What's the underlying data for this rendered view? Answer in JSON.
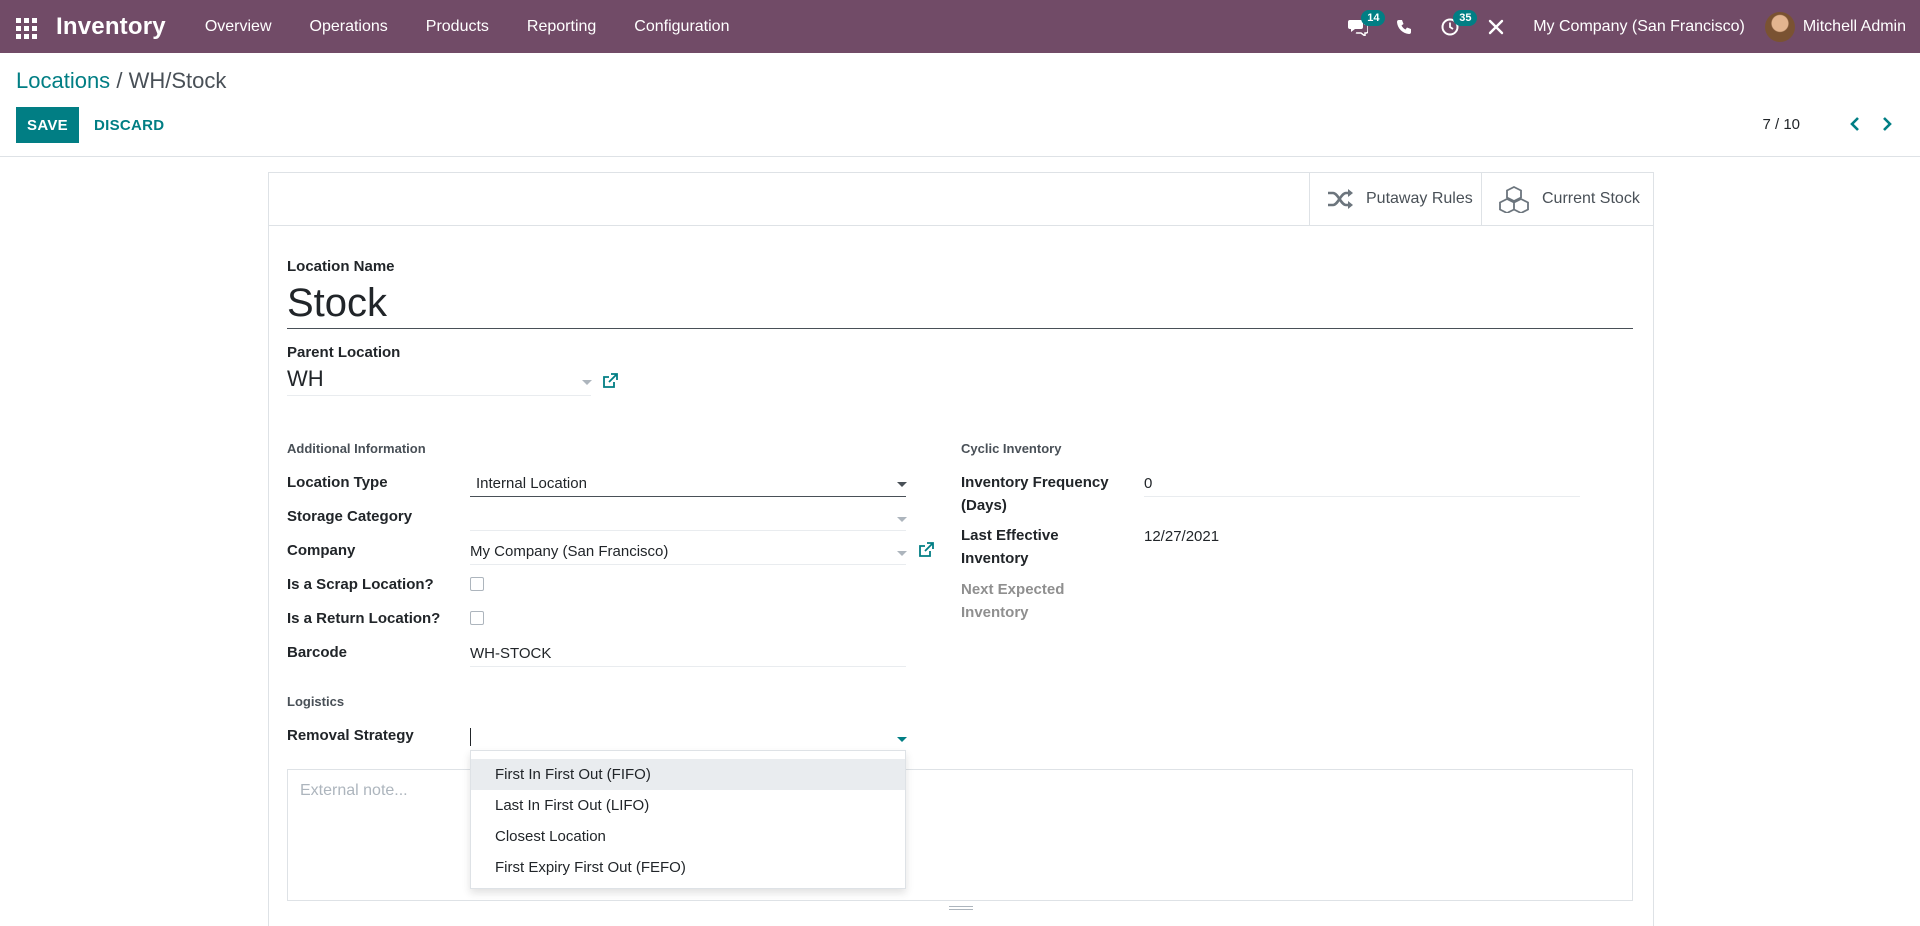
{
  "navbar": {
    "brand": "Inventory",
    "menu": [
      "Overview",
      "Operations",
      "Products",
      "Reporting",
      "Configuration"
    ],
    "messages_count": "14",
    "activities_count": "35",
    "company": "My Company (San Francisco)",
    "user": "Mitchell Admin",
    "accent_color": "#714b67"
  },
  "breadcrumb": {
    "parent": "Locations",
    "separator": "/",
    "current": "WH/Stock"
  },
  "actions": {
    "save": "SAVE",
    "discard": "DISCARD"
  },
  "pager": {
    "value": "7 / 10"
  },
  "smart_buttons": {
    "putaway": "Putaway Rules",
    "current_stock": "Current Stock"
  },
  "form": {
    "location_name_label": "Location Name",
    "location_name": "Stock",
    "parent_location_label": "Parent Location",
    "parent_location": "WH",
    "additional_info_title": "Additional Information",
    "location_type_label": "Location Type",
    "location_type": "Internal Location",
    "storage_category_label": "Storage Category",
    "storage_category": "",
    "company_label": "Company",
    "company": "My Company (San Francisco)",
    "scrap_label": "Is a Scrap Location?",
    "scrap": false,
    "return_label": "Is a Return Location?",
    "return": false,
    "barcode_label": "Barcode",
    "barcode": "WH-STOCK",
    "logistics_title": "Logistics",
    "removal_strategy_label": "Removal Strategy",
    "removal_strategy": "",
    "cyclic_title": "Cyclic Inventory",
    "freq_label_1": "Inventory Frequency",
    "freq_label_2": "(Days)",
    "freq_value": "0",
    "last_eff_label_1": "Last Effective",
    "last_eff_label_2": "Inventory",
    "last_eff_value": "12/27/2021",
    "next_exp_label_1": "Next Expected",
    "next_exp_label_2": "Inventory",
    "note_placeholder": "External note..."
  },
  "removal_options": [
    "First In First Out (FIFO)",
    "Last In First Out (LIFO)",
    "Closest Location",
    "First Expiry First Out (FEFO)"
  ]
}
